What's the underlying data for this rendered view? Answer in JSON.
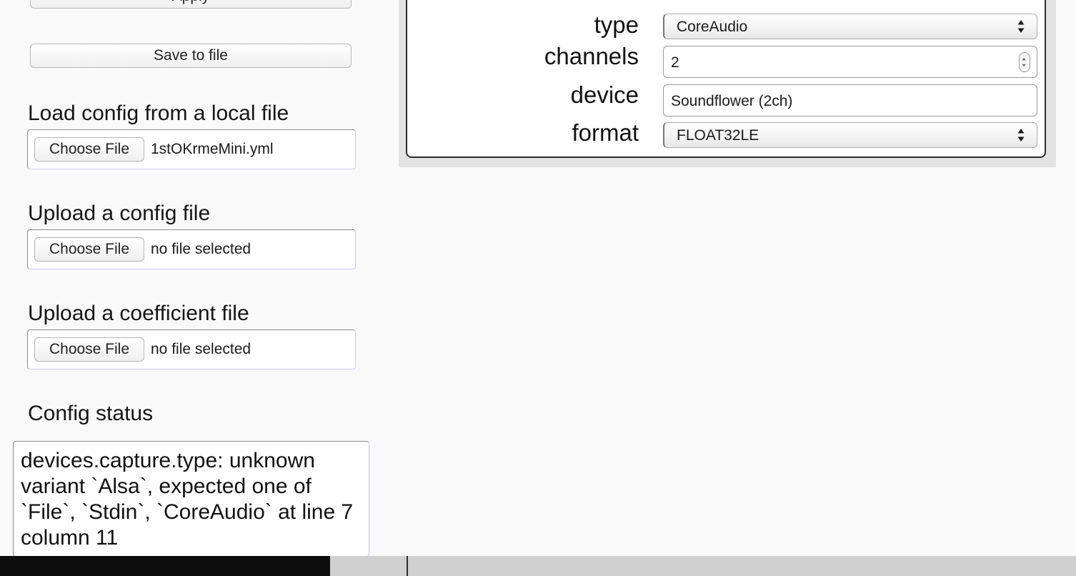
{
  "sidebar": {
    "apply_label": "Apply",
    "save_label": "Save to file",
    "load_local": {
      "heading": "Load config from a local file",
      "button_label": "Choose File",
      "file_name": "1stOKrmeMini.yml"
    },
    "upload_config": {
      "heading": "Upload a config file",
      "button_label": "Choose File",
      "file_name": "no file selected"
    },
    "upload_coefficient": {
      "heading": "Upload a coefficient file",
      "button_label": "Choose File",
      "file_name": "no file selected"
    },
    "status": {
      "heading": "Config status",
      "message": "devices.capture.type: unknown variant `Alsa`, expected one of `File`, `Stdin`, `CoreAudio` at line 7 column 11"
    }
  },
  "device_panel": {
    "fields": {
      "type": {
        "label": "type",
        "value": "CoreAudio"
      },
      "channels": {
        "label": "channels",
        "value": "2"
      },
      "device": {
        "label": "device",
        "value": "Soundflower (2ch)"
      },
      "format": {
        "label": "format",
        "value": "FLOAT32LE"
      }
    }
  },
  "colors": {
    "page_background": "#f9f9f9",
    "panel_border": "#2b2b2b",
    "panel_frame": "#e3e3e3",
    "taskbar_dark": "#0c0c0c",
    "taskbar_gray": "#d0d0d0"
  },
  "icons": [
    "select-arrows-icon",
    "number-stepper-icon"
  ]
}
